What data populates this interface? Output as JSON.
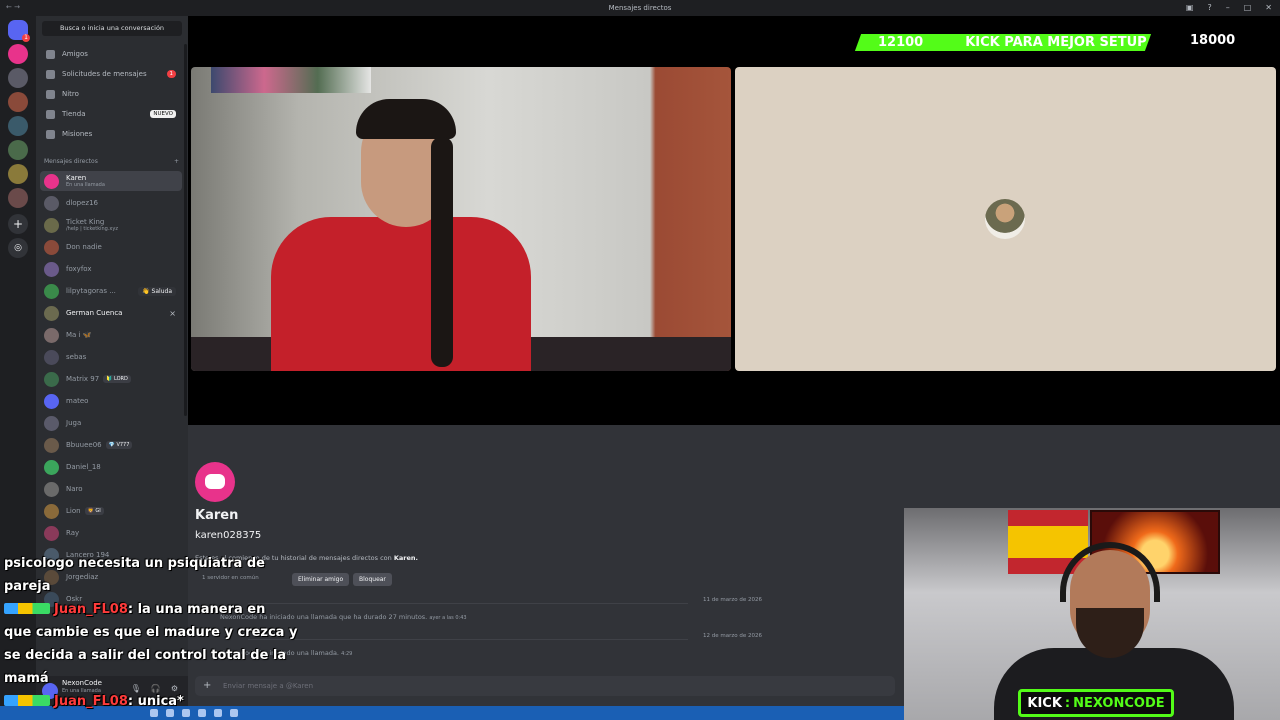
{
  "window": {
    "title": "Mensajes directos"
  },
  "sidebar": {
    "search_label": "Busca o inicia una conversación",
    "nav": [
      {
        "label": "Amigos",
        "icon": "friends-icon"
      },
      {
        "label": "Solicitudes de mensajes",
        "icon": "envelope-icon",
        "badge": "1"
      },
      {
        "label": "Nitro",
        "icon": "nitro-icon"
      },
      {
        "label": "Tienda",
        "icon": "shop-icon",
        "badge": "NUEVO"
      },
      {
        "label": "Misiones",
        "icon": "quests-icon"
      }
    ],
    "section_label": "Mensajes directos",
    "add_dm": "+",
    "dms": [
      {
        "name": "Karen",
        "status": "En una llamada",
        "color": "#e8338b",
        "active": true
      },
      {
        "name": "dlopez16",
        "color": "#5a5a66"
      },
      {
        "name": "Ticket King",
        "status": "/help | ticketking.xyz",
        "color": "#6a6a4a"
      },
      {
        "name": "Don nadie",
        "color": "#8a4a3a"
      },
      {
        "name": "foxyfox",
        "color": "#6a5a8a"
      },
      {
        "name": "lilpytagoras ...",
        "color": "#3a8a4a",
        "action": "👋 Saluda"
      },
      {
        "name": "German Cuenca",
        "color": "#6b6a4f",
        "close": "×"
      },
      {
        "name": "Ma i 🦋",
        "color": "#7a6a6a"
      },
      {
        "name": "sebas",
        "color": "#4a4a5a"
      },
      {
        "name": "Matrix 97",
        "color": "#3a6a4a",
        "tag": "🔰 LORD"
      },
      {
        "name": "mateo",
        "color": "#5865f2"
      },
      {
        "name": "Juga",
        "color": "#5a5a6a"
      },
      {
        "name": "Bbuuee06",
        "color": "#6a5a4a",
        "tag": "💎 V777"
      },
      {
        "name": "Daniel_18",
        "color": "#3ba55c"
      },
      {
        "name": "Naro",
        "color": "#6a6a6a"
      },
      {
        "name": "Lion",
        "color": "#8a6a3a",
        "tag": "🦁 GI"
      },
      {
        "name": "Ray",
        "color": "#8a3a5a"
      },
      {
        "name": "Lancero 194",
        "color": "#4a5a6a"
      },
      {
        "name": "Jorgediaz",
        "color": "#5a4a3a"
      },
      {
        "name": "Oskr",
        "color": "#3a4a5a"
      }
    ]
  },
  "call": {
    "kick_goal": {
      "current": "12100",
      "text": "KICK PARA MEJOR SETUP",
      "target": "18000"
    }
  },
  "chat": {
    "name": "Karen",
    "handle": "karen028375",
    "intro_prefix": "Este es el comienzo de tu historial de mensajes directos con",
    "intro_name": "Karen.",
    "mutual": "1 servidor en común",
    "remove_friend": "Eliminar amigo",
    "block": "Bloquear",
    "messages": [
      {
        "date": "11 de marzo de 2026",
        "text": "NexonCode ha iniciado una llamada que ha durado 27 minutos.",
        "time": "ayer a las 0:43"
      },
      {
        "date": "12 de marzo de 2026",
        "text": "NexonCode ha iniciado una llamada.",
        "time": "4:29"
      }
    ],
    "input_placeholder": "Enviar mensaje a @Karen"
  },
  "overlay_chat": [
    {
      "user": "",
      "text": "psicologo necesita un psiquiatra de"
    },
    {
      "user": "",
      "text": "pareja"
    },
    {
      "user": "Juan_FL08",
      "text": ": la una manera en"
    },
    {
      "user": "",
      "text": "que cambie es que el madure y crezca y"
    },
    {
      "user": "",
      "text": "se decida a salir del control total de la"
    },
    {
      "user": "",
      "text": "mamá"
    },
    {
      "user": "Juan_FL08",
      "text": ": unica*"
    }
  ],
  "user_panel": {
    "name": "NexonCode",
    "status": "En una llamada"
  },
  "streamer": {
    "kick_label": "KICK",
    "kick_name": "NEXONCODE"
  },
  "colors": {
    "kick_green": "#53fc18",
    "discord_blurple": "#5865f2",
    "sidebar_bg": "#2b2d31"
  }
}
